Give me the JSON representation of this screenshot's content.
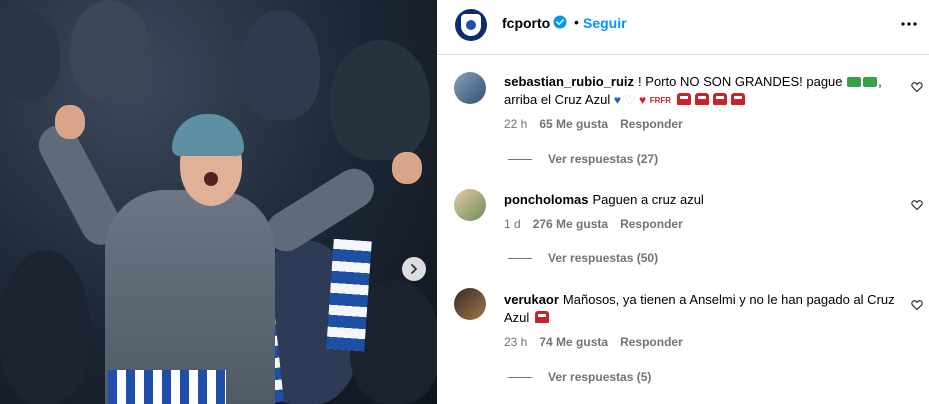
{
  "post": {
    "username": "fcporto",
    "follow_label": "Seguir",
    "separator": "•"
  },
  "comments": [
    {
      "username": "sebastian_rubio_ruiz",
      "text_1": "! Porto NO SON GRANDES! pague",
      "text_2": ", arriba el Cruz Azul",
      "badge_text": "FRFR",
      "time": "22 h",
      "likes": "65 Me gusta",
      "reply_label": "Responder",
      "replies": "Ver respuestas (27)"
    },
    {
      "username": "poncholomas",
      "text": "Paguen a cruz azul",
      "time": "1 d",
      "likes": "276 Me gusta",
      "reply_label": "Responder",
      "replies": "Ver respuestas (50)"
    },
    {
      "username": "verukaor",
      "text": "Mañosos, ya tienen a Anselmi y no le han pagado al Cruz Azul",
      "time": "23 h",
      "likes": "74 Me gusta",
      "reply_label": "Responder",
      "replies": "Ver respuestas (5)"
    }
  ],
  "icons": {
    "verified": "verified-badge-icon",
    "more": "more-options-icon",
    "like": "heart-outline-icon",
    "next": "chevron-right-icon"
  },
  "colors": {
    "accent": "#0095f6",
    "muted": "#737373",
    "border": "#dbdbdb",
    "brand_blue": "#0b2d6e"
  }
}
